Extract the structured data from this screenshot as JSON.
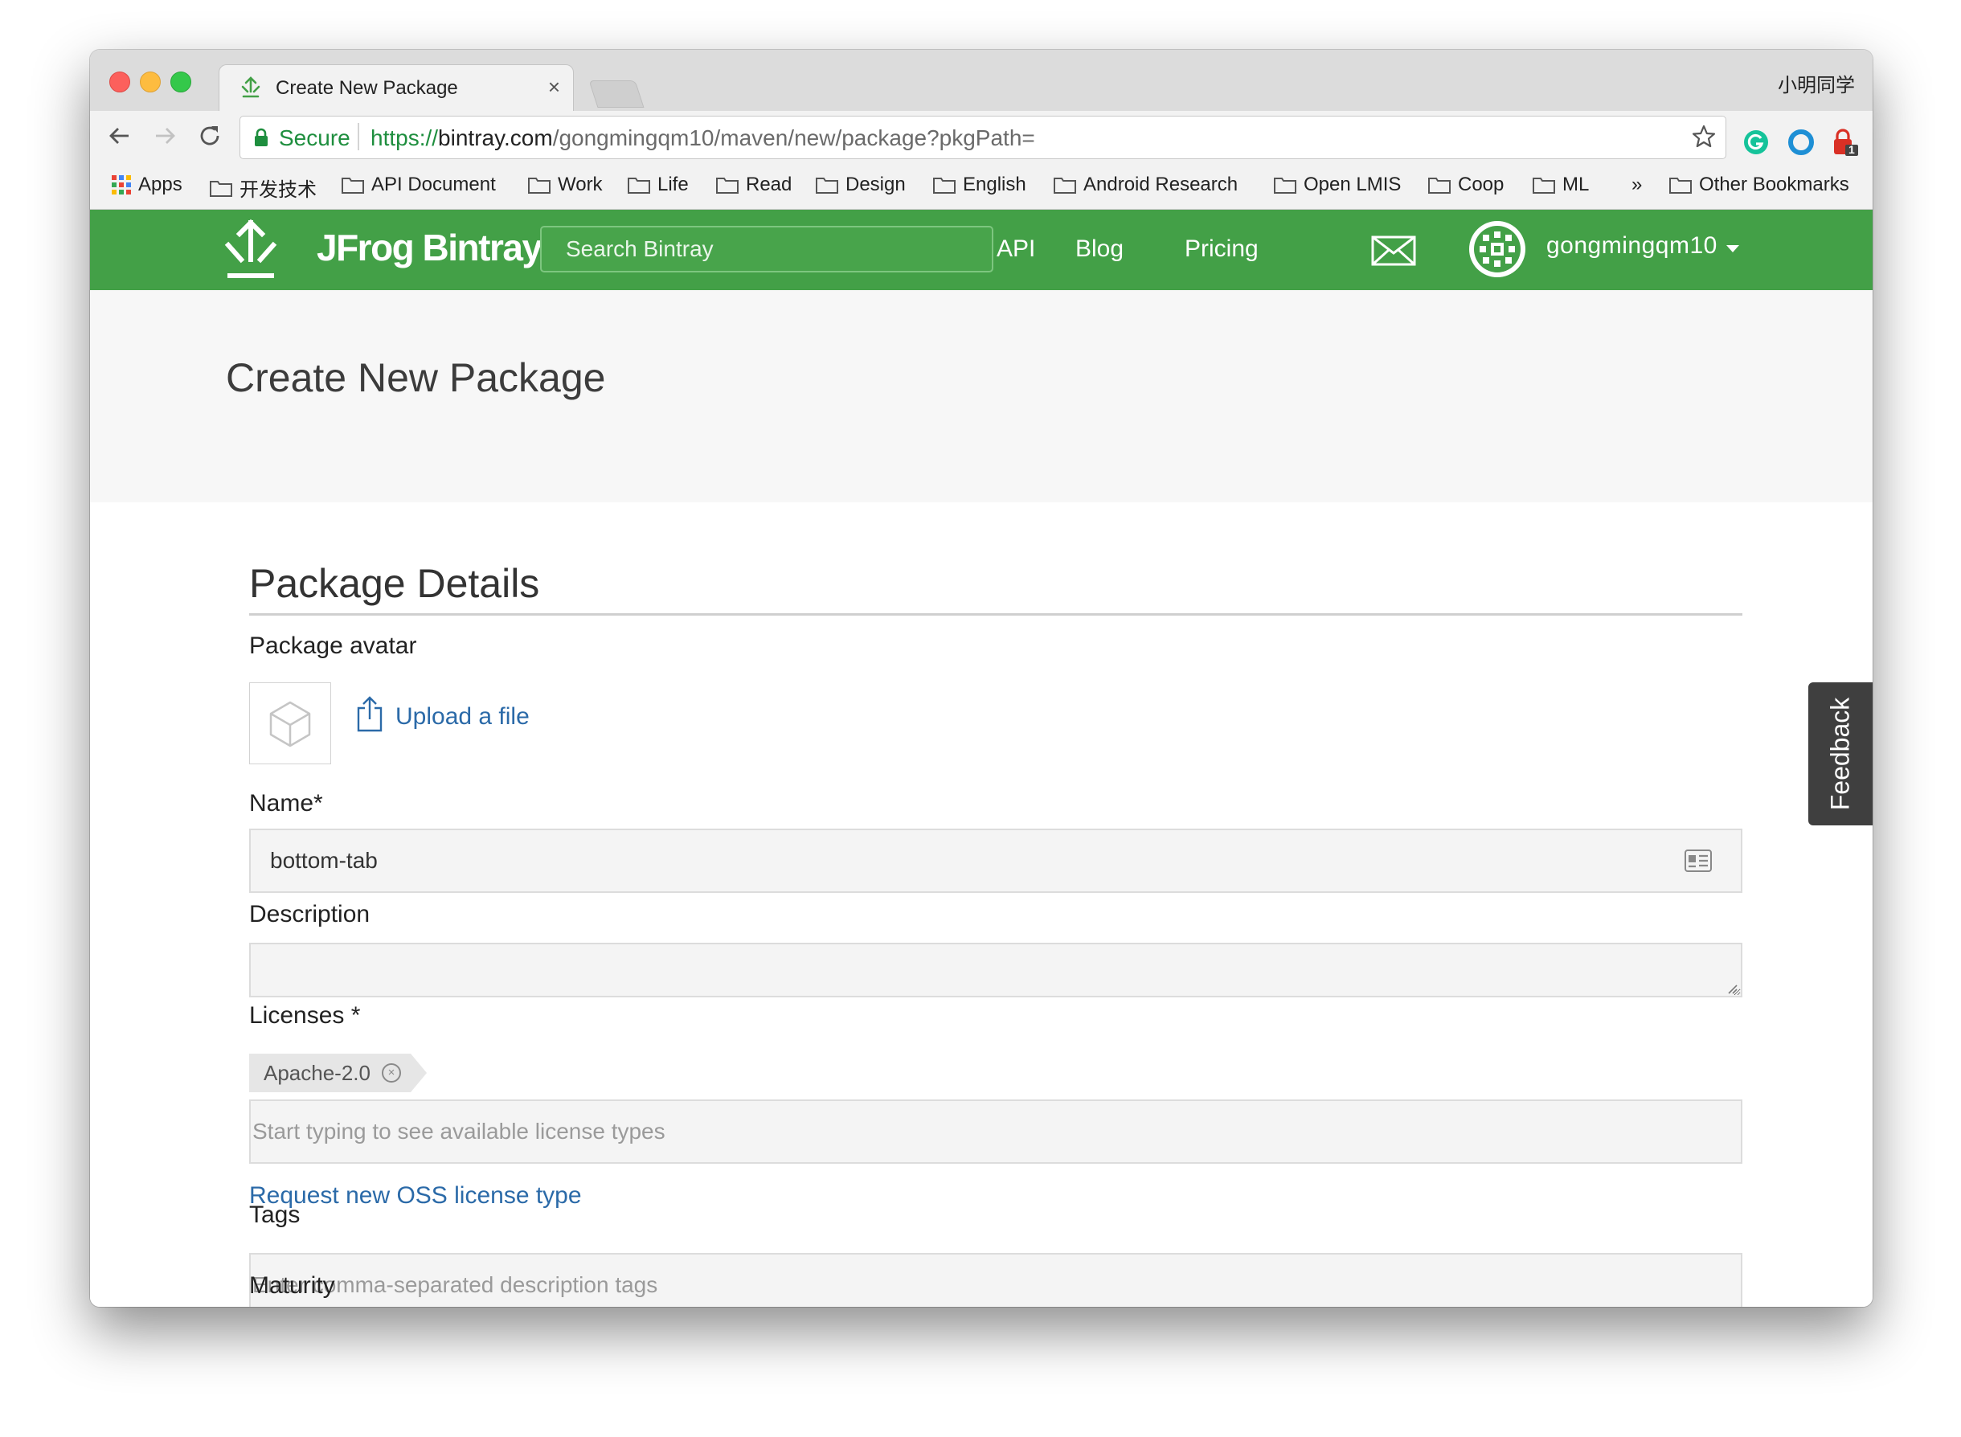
{
  "browser": {
    "tab_title": "Create New Package",
    "tab_close": "×",
    "profile_name": "小明同学",
    "secure_label": "Secure",
    "url": {
      "scheme": "https://",
      "host": "bintray.com",
      "path": "/gongmingqm10/maven/new/package?pkgPath="
    },
    "extension_badge": "1",
    "overflow_chevron": "»"
  },
  "bookmarks": [
    {
      "label": "Apps",
      "icon": "apps-grid-icon"
    },
    {
      "label": "开发技术",
      "icon": "folder-icon"
    },
    {
      "label": "API Document",
      "icon": "folder-icon"
    },
    {
      "label": "Work",
      "icon": "folder-icon"
    },
    {
      "label": "Life",
      "icon": "folder-icon"
    },
    {
      "label": "Read",
      "icon": "folder-icon"
    },
    {
      "label": "Design",
      "icon": "folder-icon"
    },
    {
      "label": "English",
      "icon": "folder-icon"
    },
    {
      "label": "Android Research",
      "icon": "folder-icon"
    },
    {
      "label": "Open LMIS",
      "icon": "folder-icon"
    },
    {
      "label": "Coop",
      "icon": "folder-icon"
    },
    {
      "label": "ML",
      "icon": "folder-icon"
    },
    {
      "label": "Other Bookmarks",
      "icon": "folder-icon"
    }
  ],
  "site": {
    "brand": "JFrog Bintray",
    "search_placeholder": "Search Bintray",
    "nav": [
      "API",
      "Blog",
      "Pricing"
    ],
    "username": "gongmingqm10",
    "accent_color": "#43a047"
  },
  "page": {
    "title": "Create New Package",
    "section_title": "Package Details",
    "avatar_label": "Package avatar",
    "upload_link": "Upload a file",
    "name_label": "Name*",
    "name_value": "bottom-tab",
    "description_label": "Description",
    "description_value": "",
    "licenses_label": "Licenses *",
    "license_chip": "Apache-2.0",
    "license_remove": "×",
    "licenses_placeholder": "Start typing to see available license types",
    "request_license_link": "Request new OSS license type",
    "tags_label": "Tags",
    "tags_placeholder": "Enter comma-separated description tags",
    "maturity_label": "Maturity"
  },
  "feedback": {
    "label": "Feedback"
  }
}
